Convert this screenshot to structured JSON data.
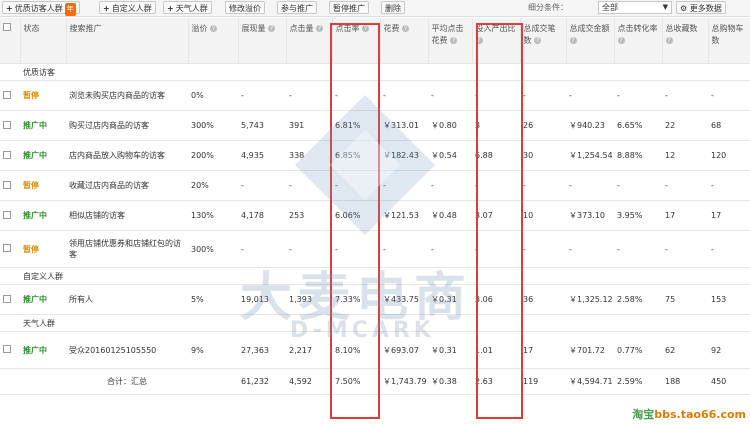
{
  "toolbar": {
    "buttons": [
      {
        "label": "优质访客人群",
        "plus": "+",
        "badge": "年"
      },
      {
        "label": "自定义人群",
        "plus": "+"
      },
      {
        "label": "天气人群",
        "plus": "+"
      },
      {
        "label": "修改溢价"
      },
      {
        "label": "参与推广"
      },
      {
        "label": "暂停推广"
      },
      {
        "label": "删除"
      }
    ],
    "filter_label": "细分条件：",
    "filter_value": "全部",
    "more_label": "更多数据"
  },
  "table": {
    "headers": [
      {
        "label": ""
      },
      {
        "label": "状态"
      },
      {
        "label": "搜索推广"
      },
      {
        "label": "溢价"
      },
      {
        "label": "展现量"
      },
      {
        "label": "点击量"
      },
      {
        "label": "点击率"
      },
      {
        "label": "花费"
      },
      {
        "label": "平均点击花费"
      },
      {
        "label": "投入产出比"
      },
      {
        "label": "总成交笔数"
      },
      {
        "label": "总成交金额"
      },
      {
        "label": "点击转化率"
      },
      {
        "label": "总收藏数"
      },
      {
        "label": "总购物车数"
      }
    ],
    "groups": [
      {
        "title": "优质访客",
        "rows": [
          {
            "status": "暂停",
            "st": "pause",
            "name": "浏览未购买店内商品的访客",
            "premium": "0%",
            "imp": "-",
            "clicks": "-",
            "ctr": "-",
            "cost": "-",
            "cpc": "-",
            "roi": "-",
            "orders": "-",
            "amount": "-",
            "cvr": "-",
            "fav": "-",
            "cart": "-"
          },
          {
            "status": "推广中",
            "st": "run",
            "name": "购买过店内商品的访客",
            "premium": "300%",
            "imp": "5,743",
            "clicks": "391",
            "ctr": "6.81%",
            "cost": "￥313.01",
            "cpc": "￥0.80",
            "roi": "3",
            "orders": "26",
            "amount": "￥940.23",
            "cvr": "6.65%",
            "fav": "22",
            "cart": "68"
          },
          {
            "status": "推广中",
            "st": "run",
            "name": "店内商品放入购物车的访客",
            "premium": "200%",
            "imp": "4,935",
            "clicks": "338",
            "ctr": "6.85%",
            "cost": "￥182.43",
            "cpc": "￥0.54",
            "roi": "6.88",
            "orders": "30",
            "amount": "￥1,254.54",
            "cvr": "8.88%",
            "fav": "12",
            "cart": "120"
          },
          {
            "status": "暂停",
            "st": "pause",
            "name": "收藏过店内商品的访客",
            "premium": "20%",
            "imp": "-",
            "clicks": "-",
            "ctr": "-",
            "cost": "-",
            "cpc": "-",
            "roi": "-",
            "orders": "-",
            "amount": "-",
            "cvr": "-",
            "fav": "-",
            "cart": "-"
          },
          {
            "status": "推广中",
            "st": "run",
            "name": "相似店铺的访客",
            "premium": "130%",
            "imp": "4,178",
            "clicks": "253",
            "ctr": "6.06%",
            "cost": "￥121.53",
            "cpc": "￥0.48",
            "roi": "3.07",
            "orders": "10",
            "amount": "￥373.10",
            "cvr": "3.95%",
            "fav": "17",
            "cart": "17"
          },
          {
            "status": "暂停",
            "st": "pause",
            "name": "领用店铺优惠券和店铺红包的访客",
            "premium": "300%",
            "imp": "-",
            "clicks": "-",
            "ctr": "-",
            "cost": "-",
            "cpc": "-",
            "roi": "-",
            "orders": "-",
            "amount": "-",
            "cvr": "-",
            "fav": "-",
            "cart": "-"
          }
        ]
      },
      {
        "title": "自定义人群",
        "rows": [
          {
            "status": "推广中",
            "st": "run",
            "name": "所有人",
            "premium": "5%",
            "imp": "19,013",
            "clicks": "1,393",
            "ctr": "7.33%",
            "cost": "￥433.75",
            "cpc": "￥0.31",
            "roi": "3.06",
            "orders": "36",
            "amount": "￥1,325.12",
            "cvr": "2.58%",
            "fav": "75",
            "cart": "153"
          }
        ]
      },
      {
        "title": "天气人群",
        "rows": [
          {
            "status": "推广中",
            "st": "run",
            "name": "受众20160125105550",
            "premium": "9%",
            "imp": "27,363",
            "clicks": "2,217",
            "ctr": "8.10%",
            "cost": "￥693.07",
            "cpc": "￥0.31",
            "roi": "1.01",
            "orders": "17",
            "amount": "￥701.72",
            "cvr": "0.77%",
            "fav": "62",
            "cart": "92"
          }
        ]
      }
    ],
    "total": {
      "label": "合计：汇总",
      "imp": "61,232",
      "clicks": "4,592",
      "ctr": "7.50%",
      "cost": "￥1,743.79",
      "cpc": "￥0.38",
      "roi": "2.63",
      "orders": "119",
      "amount": "￥4,594.71",
      "cvr": "2.59%",
      "fav": "188",
      "cart": "450"
    }
  },
  "watermark": {
    "cn": "大麦电商",
    "en": "D-MCARK"
  },
  "corner": {
    "a": "淘宝",
    "b": "bbs.",
    "c": "tao66.com"
  }
}
